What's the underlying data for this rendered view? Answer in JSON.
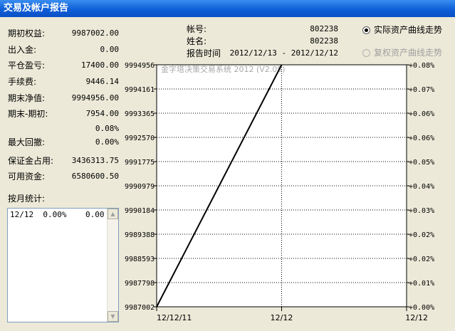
{
  "window": {
    "title": "交易及帐户报告"
  },
  "summary": [
    {
      "label": "期初权益:",
      "value": "9987002.00"
    },
    {
      "label": "出入金:",
      "value": "0.00"
    },
    {
      "label": "平仓盈亏:",
      "value": "17400.00"
    },
    {
      "label": "手续费:",
      "value": "9446.14"
    },
    {
      "label": "期末净值:",
      "value": "9994956.00"
    },
    {
      "label": "期末-期初:",
      "value": "7954.00"
    },
    {
      "label": "",
      "value": "0.08%"
    },
    {
      "label": "最大回撤:",
      "value": "0.00%"
    },
    {
      "label": "保证金占用:",
      "value": "3436313.75"
    },
    {
      "label": "可用资金:",
      "value": "6580600.50"
    }
  ],
  "account": {
    "number_label": "帐号:",
    "number": "802238",
    "name_label": "姓名:",
    "name": "802238",
    "report_time_label": "报告时间",
    "report_time": "2012/12/13 - 2012/12/12"
  },
  "view_options": {
    "actual": "实际资产曲线走势",
    "adjusted": "复权资产曲线走势",
    "selected": "actual"
  },
  "monthly": {
    "label": "按月统计:",
    "rows": [
      {
        "month": "12/12",
        "pct": "0.00%",
        "value": "0.00"
      }
    ]
  },
  "chart_data": {
    "type": "line",
    "title": "金字塔决策交易系统 2012 (V2.05)",
    "xlabel": "",
    "ylabel": "",
    "x_ticks": [
      "12/12/11",
      "12/12",
      "12/12"
    ],
    "y_left_ticks": [
      "9994956",
      "9994161",
      "9993365",
      "9992570",
      "9991775",
      "9990979",
      "9990184",
      "9989388",
      "9988593",
      "9987798",
      "9987002"
    ],
    "y_right_ticks": [
      "+0.08%",
      "+0.07%",
      "+0.06%",
      "+0.06%",
      "+0.05%",
      "+0.04%",
      "+0.03%",
      "+0.02%",
      "+0.02%",
      "+0.01%",
      "+0.00%"
    ],
    "ylim": [
      9987002,
      9994956
    ],
    "series": [
      {
        "x": [
          "12/12/11",
          "12/12"
        ],
        "values": [
          9987002,
          9994956
        ]
      }
    ],
    "line_color": "#000000",
    "grid": true
  }
}
